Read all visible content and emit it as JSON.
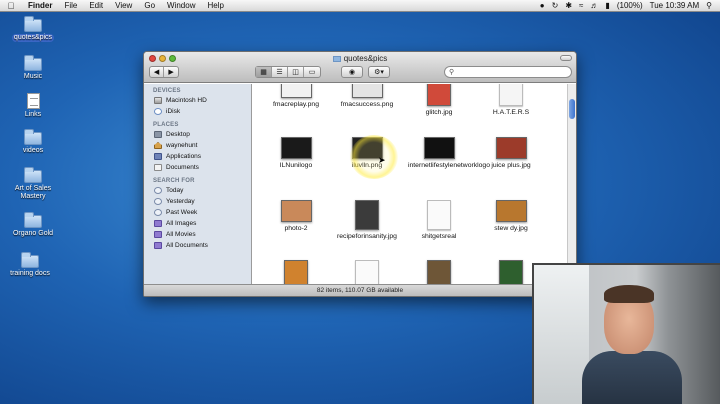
{
  "menubar": {
    "app_name": "Finder",
    "items": [
      "File",
      "Edit",
      "View",
      "Go",
      "Window",
      "Help"
    ],
    "battery": "(100%)",
    "clock": "Tue 10:39 AM"
  },
  "desktop_icons": [
    {
      "label": "quotes&pics"
    },
    {
      "label": "Music"
    },
    {
      "label": "Links"
    },
    {
      "label": "videos"
    },
    {
      "label": "Art of Sales Mastery"
    },
    {
      "label": "Organo Gold"
    },
    {
      "label": "training docs"
    }
  ],
  "window": {
    "title": "quotes&pics",
    "status": "82 items, 110.07 GB available"
  },
  "sidebar": {
    "devices_header": "DEVICES",
    "devices": [
      "Macintosh HD",
      "iDisk"
    ],
    "places_header": "PLACES",
    "places": [
      "Desktop",
      "waynehunt",
      "Applications",
      "Documents"
    ],
    "search_header": "SEARCH FOR",
    "search_for": [
      "Today",
      "Yesterday",
      "Past Week",
      "All Images",
      "All Movies",
      "All Documents"
    ]
  },
  "files": [
    {
      "name": "fmacreplay.png",
      "color": "#f1f1f1"
    },
    {
      "name": "fmacsuccess.png",
      "color": "#e4e4e4"
    },
    {
      "name": "glitch.jpg",
      "color": "#d04a3a"
    },
    {
      "name": "H.A.T.E.R.S",
      "color": "#f5f5f5"
    },
    {
      "name": "ILNunilogo",
      "color": "#1a1a1a"
    },
    {
      "name": "iluvlln.png",
      "color": "#222222"
    },
    {
      "name": "internetlifestylenetworklogo",
      "color": "#111111"
    },
    {
      "name": "juice plus.jpg",
      "color": "#9c3b2a"
    },
    {
      "name": "photo-2",
      "color": "#c9895a"
    },
    {
      "name": "recipeforinsanity.jpg",
      "color": "#3b3b3b"
    },
    {
      "name": "shitgetsreal",
      "color": "#fafafa"
    },
    {
      "name": "stew dy.jpg",
      "color": "#b8772e"
    },
    {
      "name": "",
      "color": "#d0822e"
    },
    {
      "name": "",
      "color": "#fafafa"
    },
    {
      "name": "",
      "color": "#6e5637"
    },
    {
      "name": "",
      "color": "#2e5f2e"
    }
  ]
}
